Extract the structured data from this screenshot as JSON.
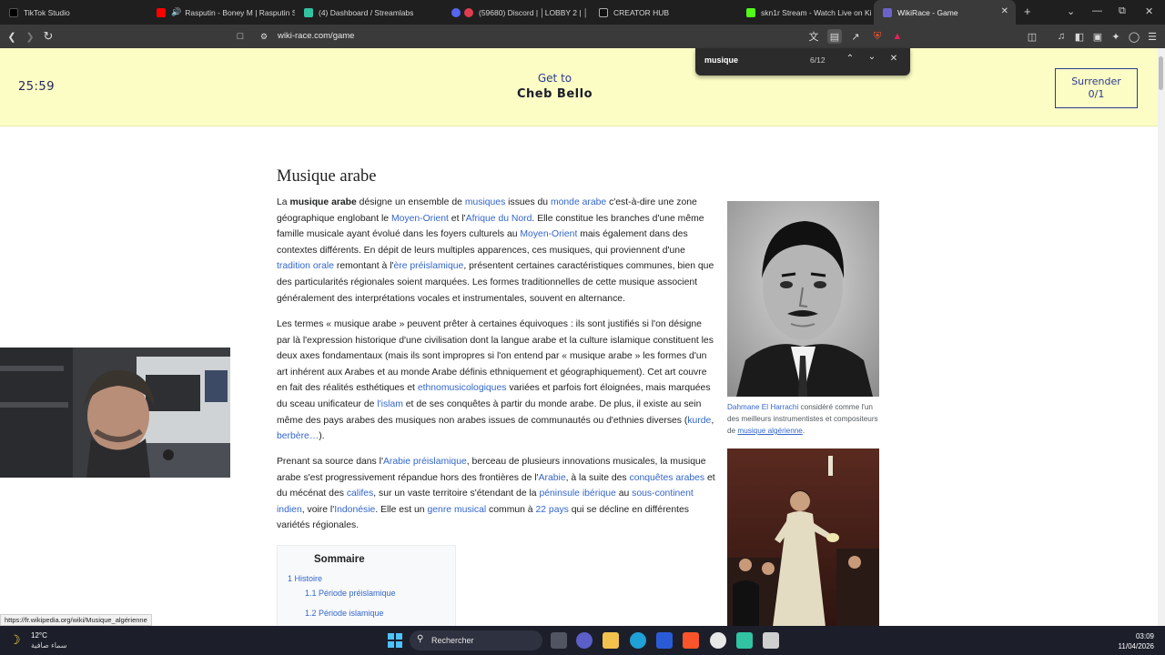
{
  "browser": {
    "tabs": [
      {
        "label": "TikTok Studio",
        "icon": "tiktok-icon",
        "color": "#000000"
      },
      {
        "label": "Rasputin - Boney M | Rasputin S",
        "icon": "youtube-icon",
        "color": "#ff0000"
      },
      {
        "label": "(4) Dashboard / Streamlabs",
        "icon": "streamlabs-icon",
        "color": "#31c3a2"
      },
      {
        "label": "(59680) Discord | │LOBBY 2 | │",
        "icon": "discord-icon",
        "color": "#5865f2"
      },
      {
        "label": "CREATOR HUB",
        "icon": "kick-icon",
        "color": "#111111"
      },
      {
        "label": "skn1r Stream - Watch Live on Ki",
        "icon": "kick-icon",
        "color": "#53fc18"
      },
      {
        "label": "WikiRace - Game",
        "icon": "wikirace-icon",
        "color": "#6b63c9"
      }
    ],
    "url": "wiki-race.com/game",
    "find": {
      "query": "musique",
      "count": "6/12"
    },
    "status_url": "https://fr.wikipedia.org/wiki/Musique_algérienne"
  },
  "game": {
    "timer": "25:59",
    "goal_label": "Get to",
    "goal_target": "Cheb Bello",
    "surrender_label": "Surrender",
    "surrender_count": "0/1"
  },
  "article": {
    "title": "Musique arabe",
    "para1": {
      "t1": "La ",
      "bold": "musique arabe",
      "t2": " désigne un ensemble de ",
      "l1": "musiques",
      "t3": " issues du ",
      "l2": "monde arabe",
      "t4": " c'est-à-dire une zone géographique englobant le ",
      "l3": "Moyen-Orient",
      "t5": " et l'",
      "l4": "Afrique du Nord",
      "t6": ". Elle constitue les branches d'une même famille musicale ayant évolué dans les foyers culturels au ",
      "l5": "Moyen-Orient",
      "t7": " mais également dans des contextes différents. En dépit de leurs multiples apparences, ces musiques, qui proviennent d'une ",
      "l6": "tradition orale",
      "t8": " remontant à l'",
      "l7": "ère préislamique",
      "t9": ", présentent certaines caractéristiques communes, bien que des particularités régionales soient marquées. Les formes traditionnelles de cette musique associent généralement des interprétations vocales et instrumentales, souvent en alternance."
    },
    "para2": {
      "t1": "Les termes « musique arabe » peuvent prêter à certaines équivoques : ils sont justifiés si l'on désigne par là l'expression historique d'une civilisation dont la langue arabe et la culture islamique constituent les deux axes fondamentaux (mais ils sont impropres si l'on entend par « musique arabe » les formes d'un art inhérent aux Arabes et au monde Arabe définis ethniquement et géographiquement). Cet art couvre en fait des réalités esthétiques et ",
      "l1": "ethnomusicologiques",
      "t2": " variées et parfois fort éloignées, mais marquées du sceau unificateur de ",
      "l2": "l'islam",
      "t3": " et de ses conquêtes à partir du monde arabe. De plus, il existe au sein même des pays arabes des musiques non arabes issues de communautés ou d'ethnies diverses (",
      "l3": "kurde",
      "t4": ", ",
      "l4": "berbère",
      "t5": "",
      "l5": "…",
      "t6": ")."
    },
    "para3": {
      "t1": "Prenant sa source dans l'",
      "l1": "Arabie préislamique",
      "t2": ", berceau de plusieurs innovations musicales, la musique arabe s'est progressivement répandue hors des frontières de l'",
      "l2": "Arabie",
      "t3": ", à la suite des ",
      "l3": "conquêtes arabes",
      "t4": " et du mécénat des ",
      "l4": "califes",
      "t5": ", sur un vaste territoire s'étendant de la ",
      "l5": "péninsule ibérique",
      "t6": " au ",
      "l6": "sous-continent indien",
      "t7": ", voire l'",
      "l7": "Indonésie",
      "t8": ". Elle est un ",
      "l8": "genre musical",
      "t9": " commun à ",
      "l9": "22 pays",
      "t10": " qui se décline en différentes variétés régionales."
    },
    "toc": {
      "title": "Sommaire",
      "items": [
        {
          "label": "1 Histoire"
        },
        {
          "label": "1.1 Période préislamique"
        },
        {
          "label": "1.2 Période islamique"
        }
      ]
    },
    "caption": {
      "link1": "Dahmane El Harrachi",
      "text": " considéré comme l'un des meilleurs instrumentistes et compositeurs de ",
      "link2": "musique algérienne",
      "end": "."
    }
  },
  "taskbar": {
    "temperature": "12°C",
    "weather": "سماء صافية",
    "search_placeholder": "Rechercher",
    "time": "03:09",
    "date": "11/04/2026"
  },
  "colors": {
    "banner": "#fbfdc5",
    "link": "#3366cc",
    "accent": "#2c3a8f"
  }
}
